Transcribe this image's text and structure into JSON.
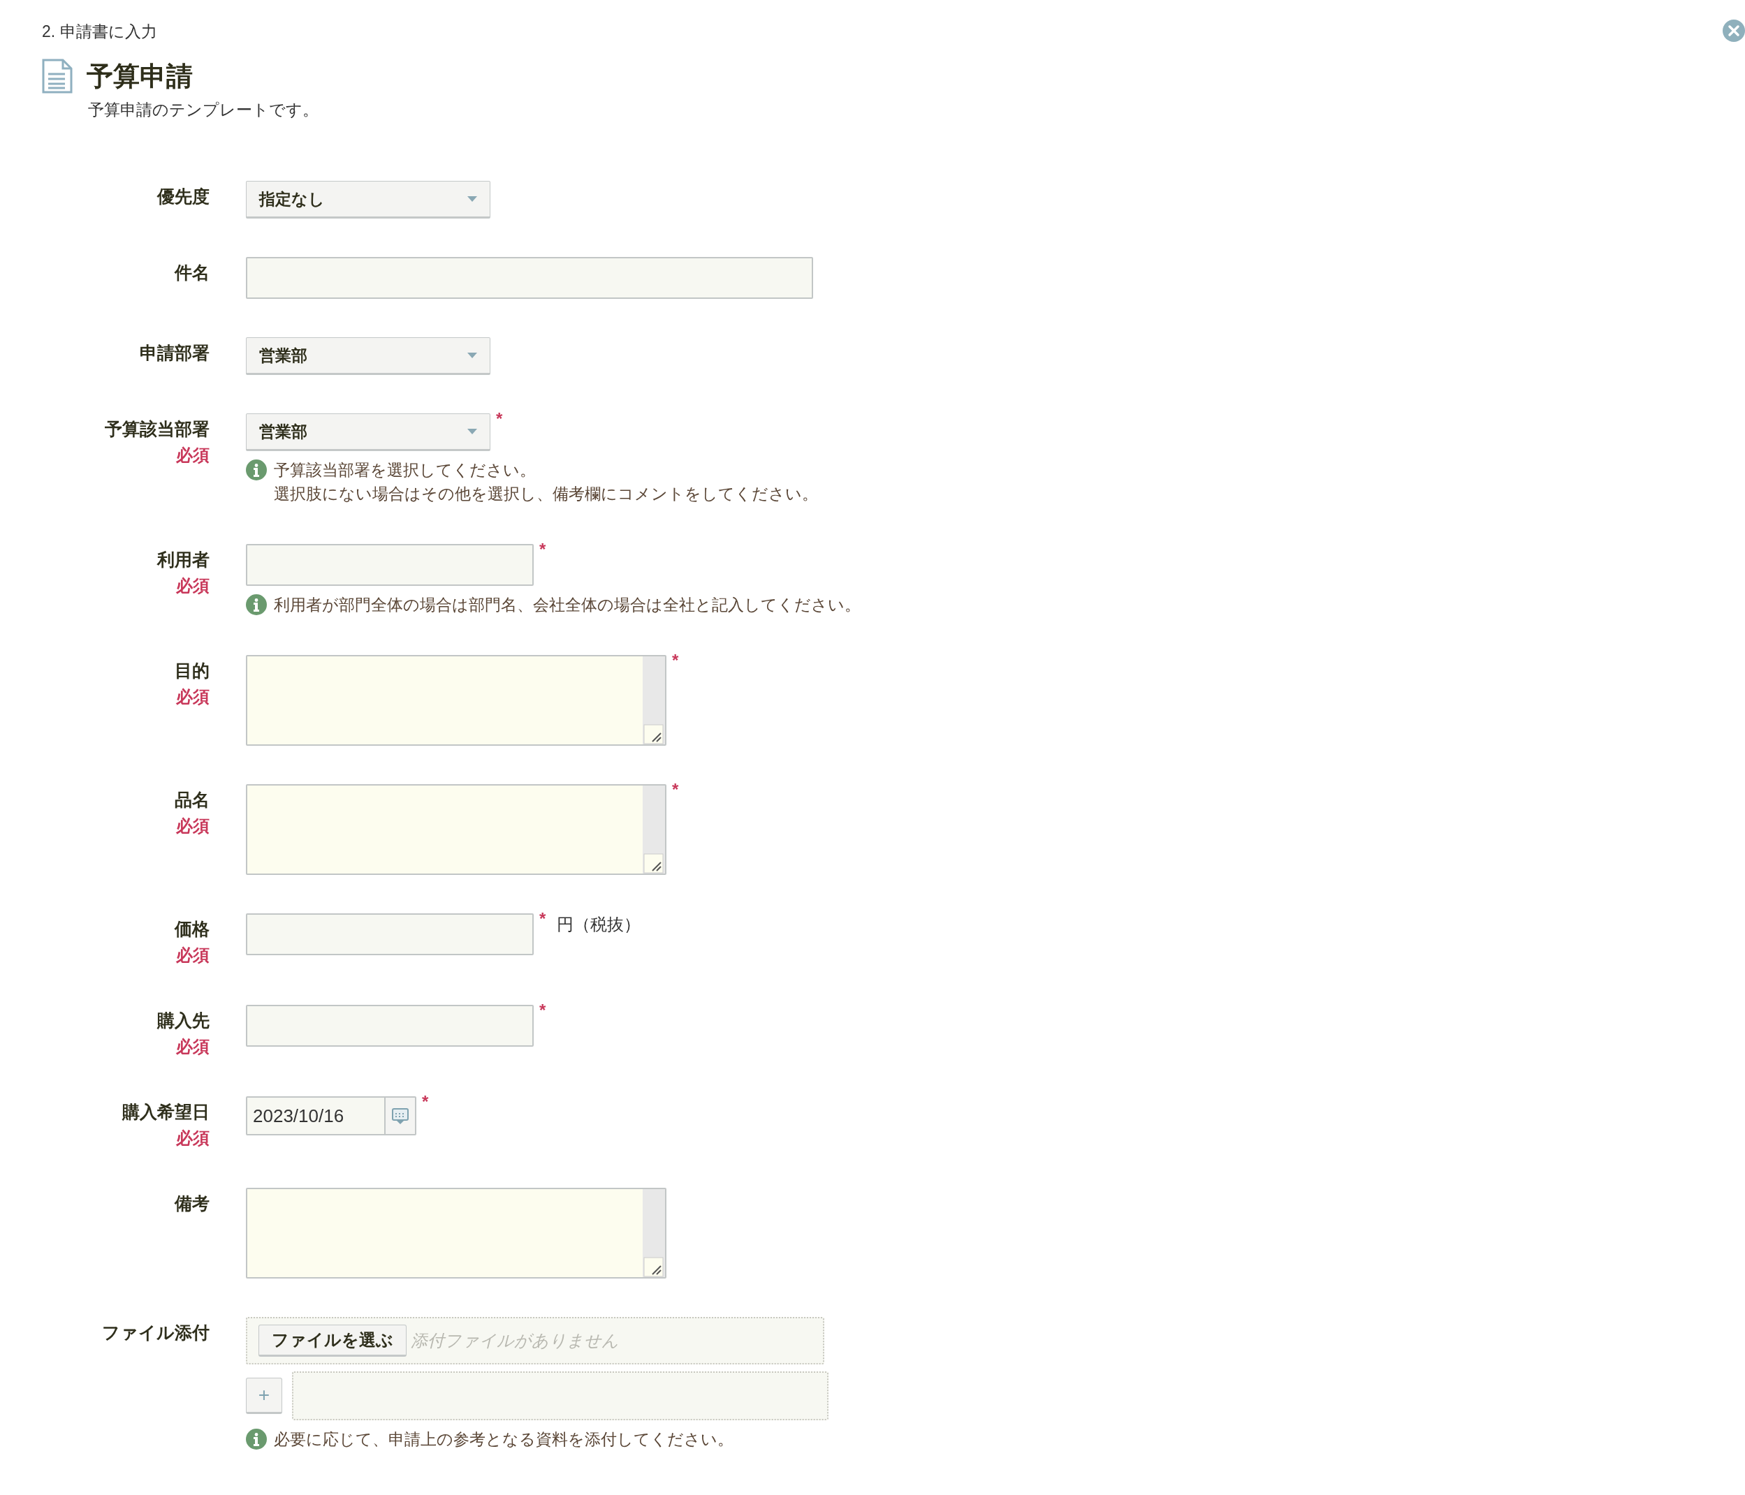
{
  "breadcrumb": "2. 申請書に入力",
  "title": "予算申請",
  "description": "予算申請のテンプレートです。",
  "fields": [
    {
      "kind": "select",
      "label": "優先度",
      "value": "指定なし"
    },
    {
      "kind": "text_long",
      "label": "件名"
    },
    {
      "kind": "select",
      "label": "申請部署",
      "value": "営業部"
    },
    {
      "kind": "select",
      "label": "予算該当部署",
      "required_tag": "必須",
      "required_mark": "*",
      "value": "営業部",
      "hint": [
        "予算該当部署を選択してください。",
        "選択肢にない場合はその他を選択し、備考欄にコメントをしてください。"
      ]
    },
    {
      "kind": "text",
      "label": "利用者",
      "required_tag": "必須",
      "required_mark": "*",
      "hint": [
        "利用者が部門全体の場合は部門名、会社全体の場合は全社と記入してください。"
      ]
    },
    {
      "kind": "textarea",
      "label": "目的",
      "required_tag": "必須",
      "required_mark": "*"
    },
    {
      "kind": "textarea",
      "label": "品名",
      "required_tag": "必須",
      "required_mark": "*"
    },
    {
      "kind": "text",
      "label": "価格",
      "required_tag": "必須",
      "required_mark": "*",
      "unit": "円（税抜）"
    },
    {
      "kind": "text",
      "label": "購入先",
      "required_tag": "必須",
      "required_mark": "*"
    },
    {
      "kind": "date",
      "label": "購入希望日",
      "required_tag": "必須",
      "required_mark": "*",
      "value": "2023/10/16"
    },
    {
      "kind": "textarea",
      "label": "備考"
    },
    {
      "kind": "file",
      "label": "ファイル添付",
      "button": "ファイルを選ぶ",
      "placeholder": "添付ファイルがありません",
      "add_button": "+",
      "hint": [
        "必要に応じて、申請上の参考となる資料を添付してください。"
      ]
    }
  ]
}
